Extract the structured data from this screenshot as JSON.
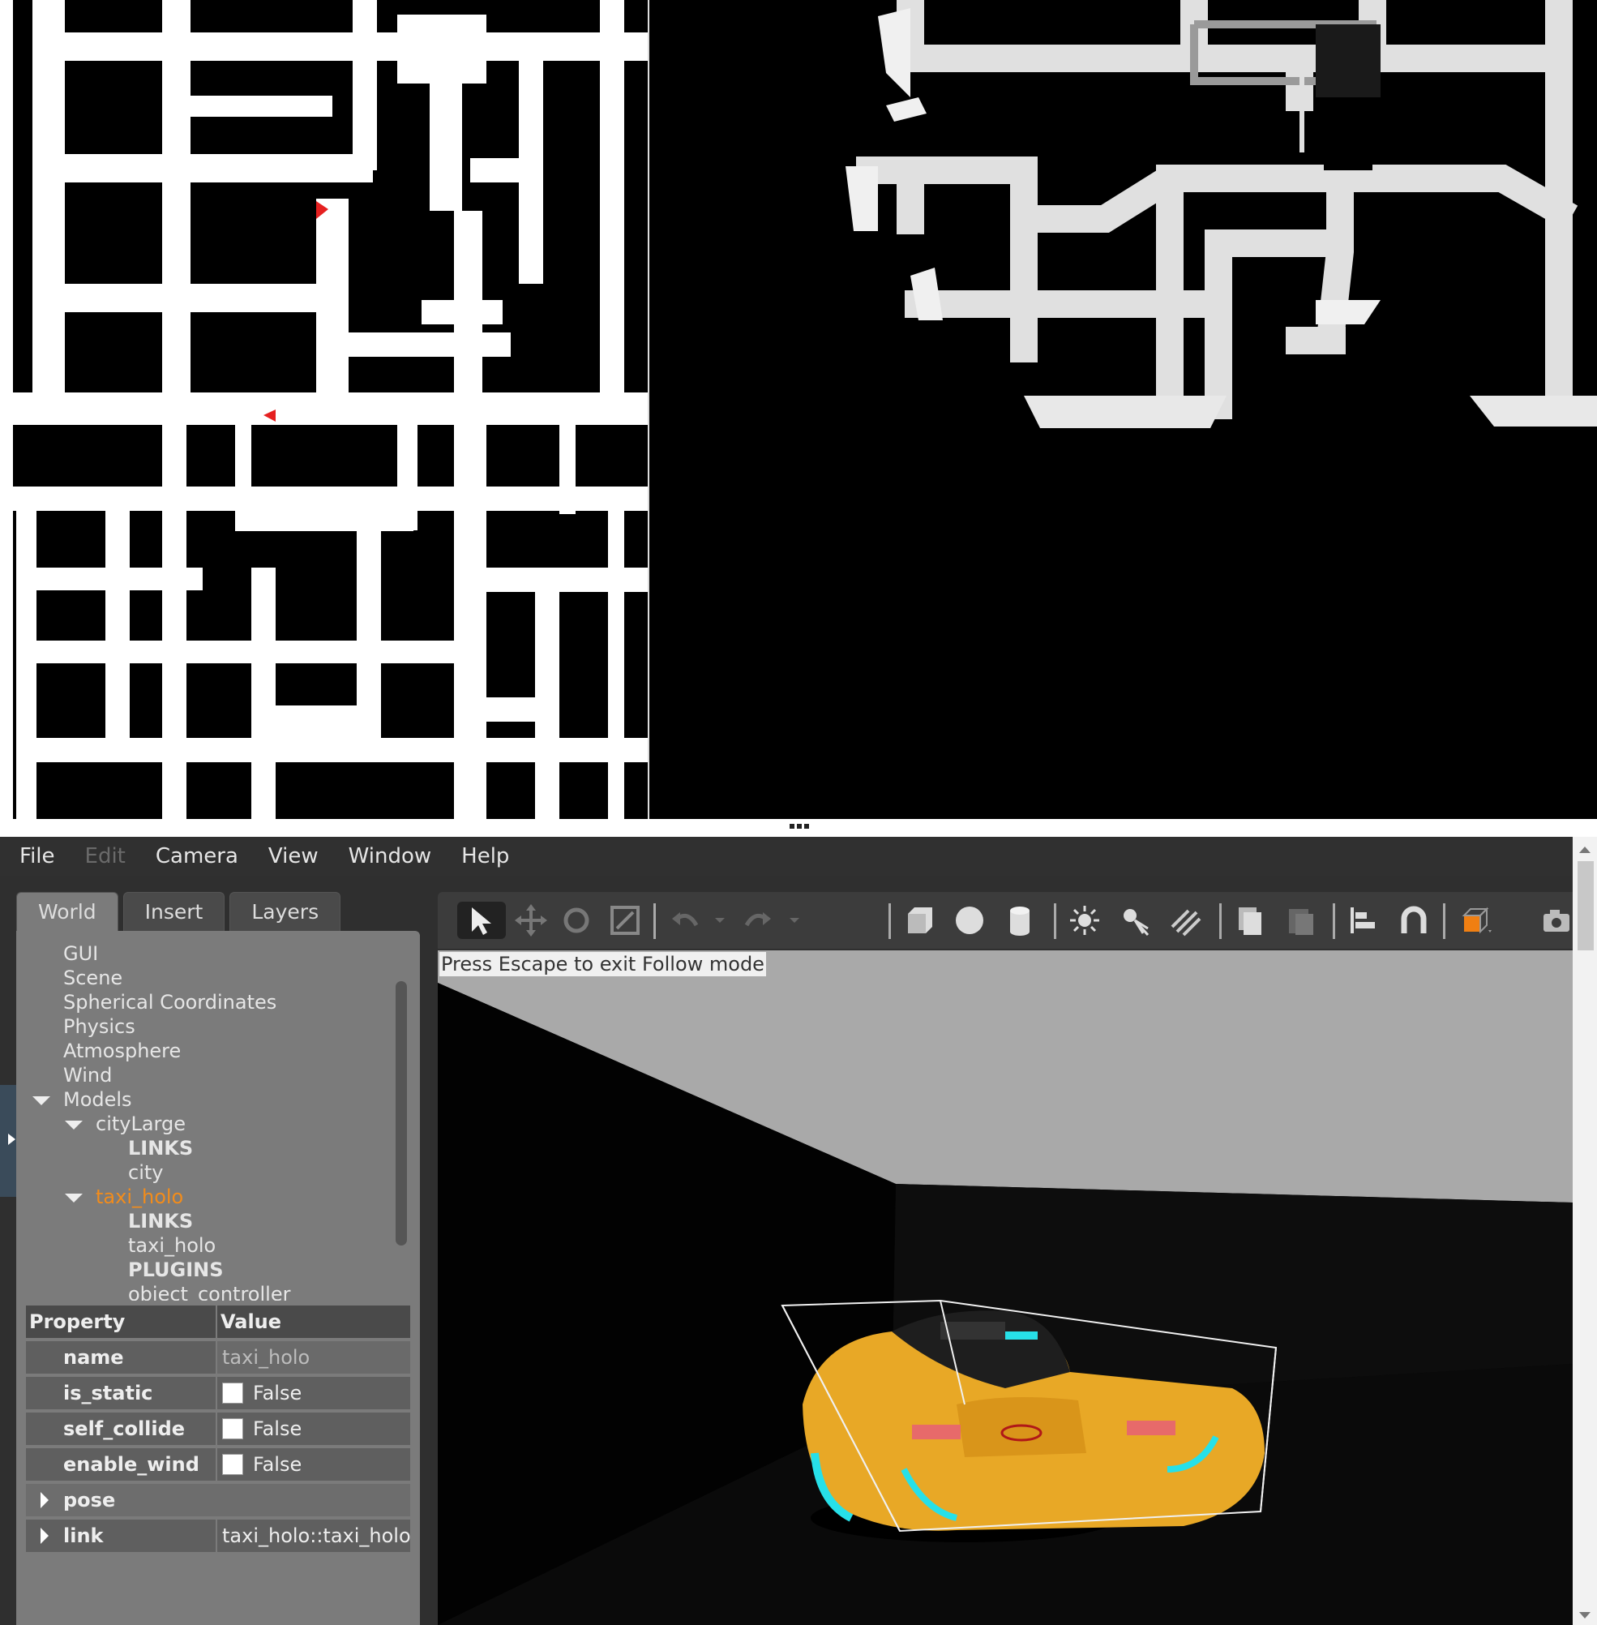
{
  "menu": {
    "file": "File",
    "edit": "Edit",
    "camera": "Camera",
    "view": "View",
    "window": "Window",
    "help": "Help"
  },
  "tabs": {
    "world": "World",
    "insert": "Insert",
    "layers": "Layers"
  },
  "tree": {
    "gui": "GUI",
    "scene": "Scene",
    "spherical": "Spherical Coordinates",
    "physics": "Physics",
    "atmosphere": "Atmosphere",
    "wind": "Wind",
    "models": "Models",
    "city_large": "cityLarge",
    "links1": "LINKS",
    "city": "city",
    "taxi_holo": "taxi_holo",
    "links2": "LINKS",
    "taxi_holo_link": "taxi_holo",
    "plugins": "PLUGINS",
    "object_controller": "object_controller"
  },
  "properties": {
    "header": {
      "property": "Property",
      "value": "Value"
    },
    "rows": [
      {
        "key": "name",
        "value": "taxi_holo"
      },
      {
        "key": "is_static",
        "value": "False"
      },
      {
        "key": "self_collide",
        "value": "False"
      },
      {
        "key": "enable_wind",
        "value": "False"
      },
      {
        "key": "pose",
        "value": ""
      },
      {
        "key": "link",
        "value": "taxi_holo::taxi_holo"
      }
    ]
  },
  "viewport": {
    "follow_message": "Press Escape to exit Follow mode"
  },
  "colors": {
    "selection": "#f28c1b",
    "car_body": "#e8a826",
    "accent": "#27e0e8"
  }
}
